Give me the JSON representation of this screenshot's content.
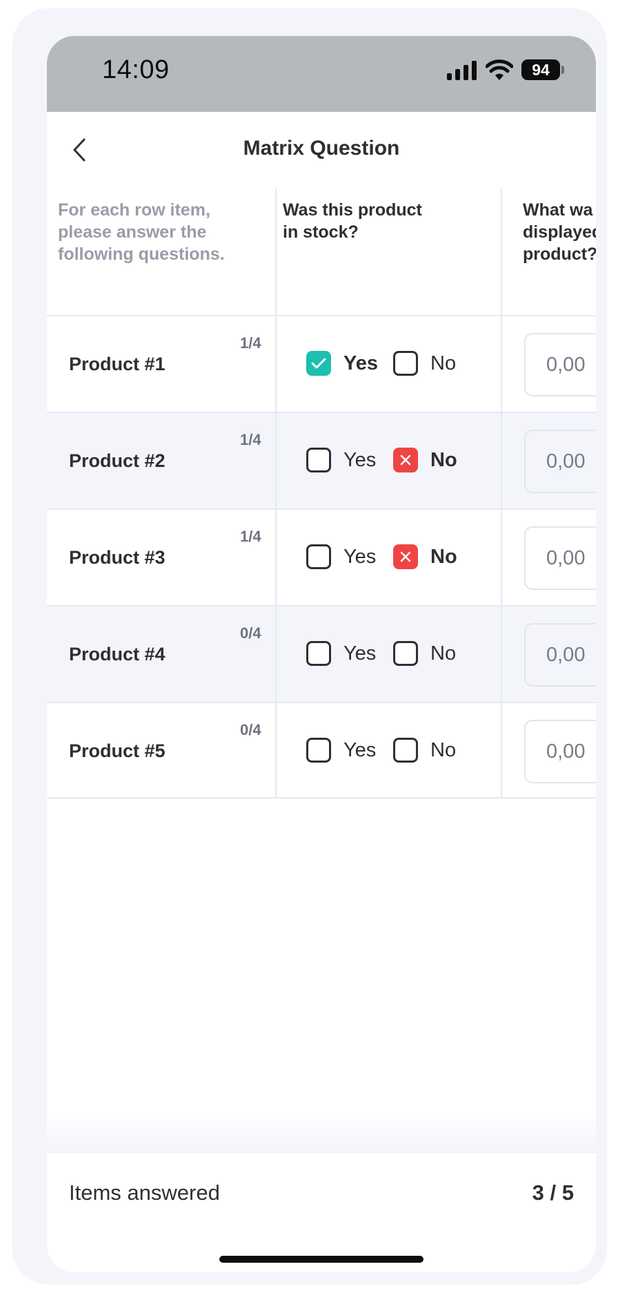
{
  "status_bar": {
    "time": "14:09",
    "battery": "94",
    "icons": [
      "signal-icon",
      "wifi-icon",
      "battery-icon"
    ]
  },
  "nav": {
    "title": "Matrix Question",
    "back_icon": "chevron-left-icon"
  },
  "matrix": {
    "intro": "For each row item, please answer the following questions.",
    "columns": [
      {
        "label": "Was this product in stock?"
      },
      {
        "label": "What wa displayed product?"
      }
    ],
    "options": {
      "yes": "Yes",
      "no": "No"
    },
    "rows": [
      {
        "label": "Product #1",
        "count": "1/4",
        "answer": "yes",
        "value": "0,00"
      },
      {
        "label": "Product #2",
        "count": "1/4",
        "answer": "no",
        "value": "0,00"
      },
      {
        "label": "Product #3",
        "count": "1/4",
        "answer": "no",
        "value": "0,00"
      },
      {
        "label": "Product #4",
        "count": "0/4",
        "answer": "",
        "value": "0,00"
      },
      {
        "label": "Product #5",
        "count": "0/4",
        "answer": "",
        "value": "0,00"
      }
    ]
  },
  "footer": {
    "label": "Items answered",
    "value": "3 / 5"
  },
  "colors": {
    "check_yes": "#1dbfae",
    "check_no": "#ef4444",
    "status_bar_bg": "#b6b9bb",
    "alt_row_bg": "#f4f5fa"
  }
}
